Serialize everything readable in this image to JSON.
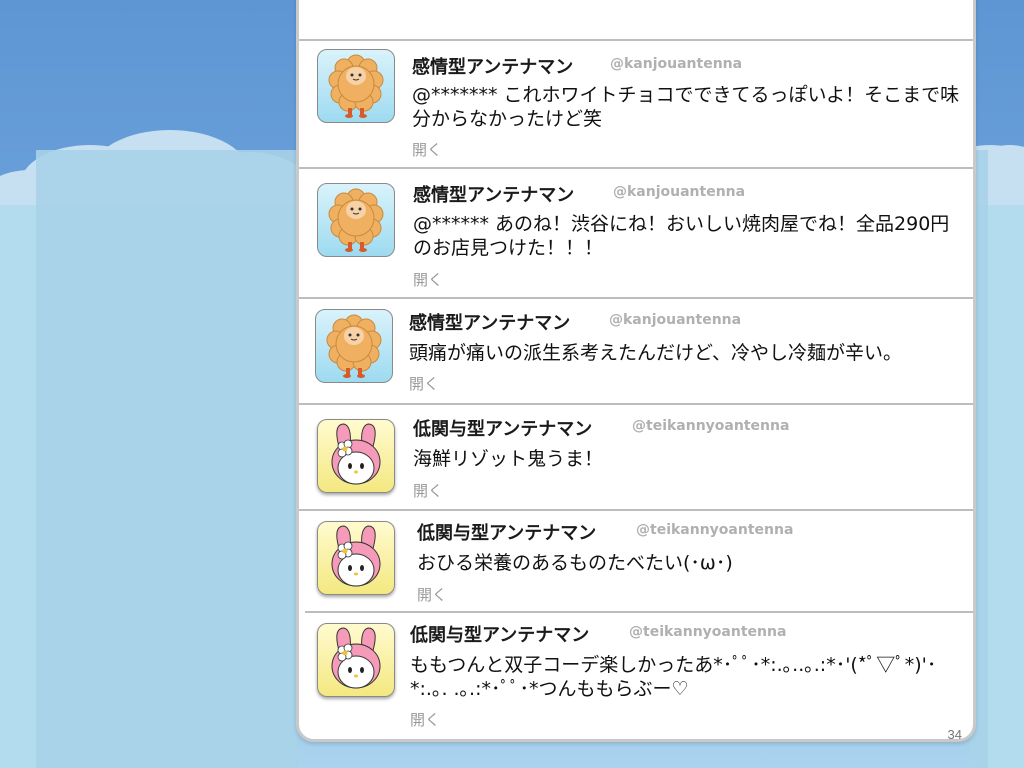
{
  "tweets": [
    {
      "name": "感情型アンテナマン",
      "handle": "@kanjouantenna",
      "text": "@******* これホワイトチョコでできてるっぽいよ！そこまで味分からなかったけど笑",
      "open_label": "開く",
      "avatar": "sheep-mascot-avatar"
    },
    {
      "name": "感情型アンテナマン",
      "handle": "@kanjouantenna",
      "text": "@****** あのね！渋谷にね！おいしい焼肉屋でね！全品290円のお店見つけた！！！",
      "open_label": "開く",
      "avatar": "sheep-mascot-avatar"
    },
    {
      "name": "感情型アンテナマン",
      "handle": "@kanjouantenna",
      "text": "頭痛が痛いの派生系考えたんだけど、冷やし冷麺が辛い。",
      "open_label": "開く",
      "avatar": "sheep-mascot-avatar"
    },
    {
      "name": "低関与型アンテナマン",
      "handle": "@teikannyoantenna",
      "text": "海鮮リゾット鬼うま！",
      "open_label": "開く",
      "avatar": "rabbit-mascot-avatar"
    },
    {
      "name": "低関与型アンテナマン",
      "handle": "@teikannyoantenna",
      "text": "おひる栄養のあるものたべたい(･ω･)",
      "open_label": "開く",
      "avatar": "rabbit-mascot-avatar"
    },
    {
      "name": "低関与型アンテナマン",
      "handle": "@teikannyoantenna",
      "text": "ももつんと双子コーデ楽しかったあ*･ﾟﾟ･*:.｡..｡.:*･'(*ﾟ▽ﾟ*)'･*:.｡. .｡.:*･ﾟﾟ･*つんももらぶー♡",
      "open_label": "開く",
      "avatar": "rabbit-mascot-avatar"
    }
  ],
  "page_number": "34",
  "colors": {
    "sky_top": "#5d96d4",
    "sky_bottom": "#a9d3ee",
    "handle_gray": "#b0b0b0",
    "separator": "#bdbdbd"
  }
}
